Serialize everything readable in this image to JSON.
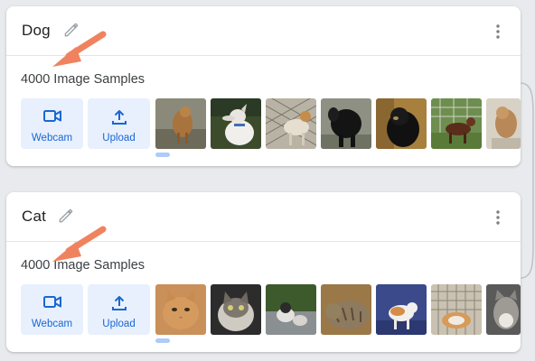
{
  "cards": [
    {
      "class_name": "Dog",
      "sample_count": "4000 Image Samples",
      "webcam_label": "Webcam",
      "upload_label": "Upload",
      "thumbnails": [
        "dog-photo-1",
        "dog-photo-2",
        "dog-photo-3",
        "dog-photo-4",
        "dog-photo-5",
        "dog-photo-6",
        "dog-photo-7"
      ]
    },
    {
      "class_name": "Cat",
      "sample_count": "4000 Image Samples",
      "webcam_label": "Webcam",
      "upload_label": "Upload",
      "thumbnails": [
        "cat-photo-1",
        "cat-photo-2",
        "cat-photo-3",
        "cat-photo-4",
        "cat-photo-5",
        "cat-photo-6",
        "cat-photo-7"
      ]
    }
  ],
  "icons": {
    "edit": "pencil-icon",
    "menu": "more-vert-icon",
    "webcam": "videocam-icon",
    "upload": "upload-icon"
  },
  "colors": {
    "accent": "#1967d2",
    "button_bg": "#e8f0fe",
    "annotation_arrow": "#f0835f",
    "page_bg": "#e8eaed"
  }
}
